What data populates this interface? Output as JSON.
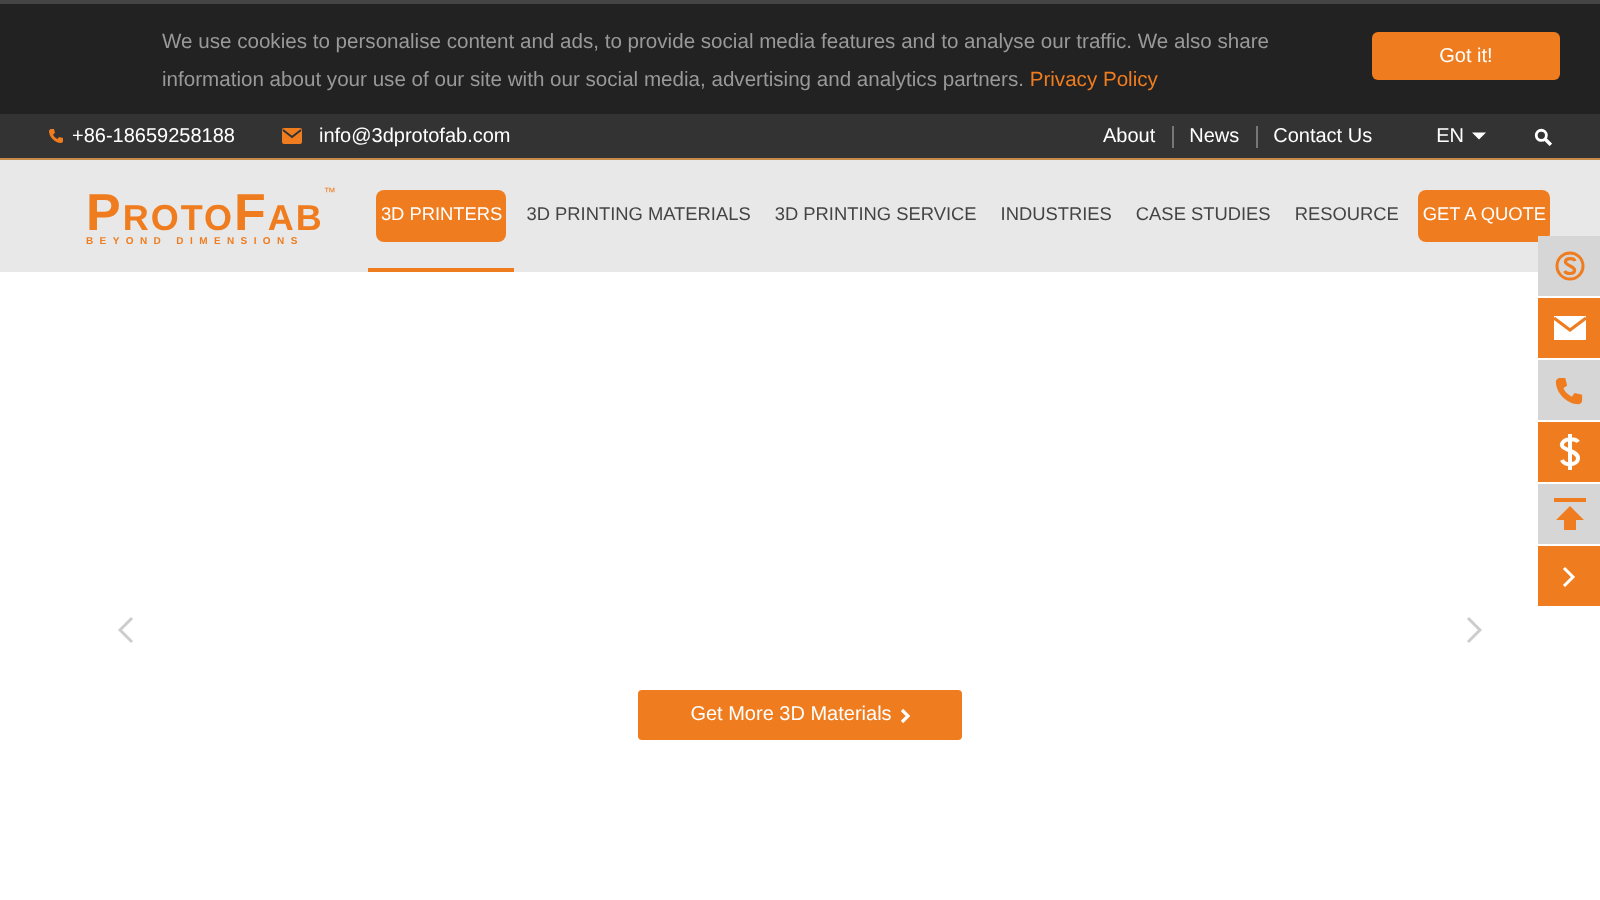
{
  "cookie_bar": {
    "message": "We use cookies to personalise content and ads, to provide social media features and to analyse our traffic. We also share information about your use of our site with our social media, advertising and analytics partners.",
    "link": "Privacy Policy",
    "button": "Got it!"
  },
  "top_bar": {
    "phone": "+86-18659258188",
    "email": "info@3dprotofab.com",
    "links": [
      "About",
      "News",
      "Contact Us"
    ],
    "language": "EN"
  },
  "header": {
    "logo": {
      "name": "ProtoFab",
      "trademark": "™",
      "tagline": "BEYOND DIMENSIONS"
    },
    "nav": [
      {
        "label": "3D PRINTERS",
        "kind": "link",
        "selected": true
      },
      {
        "label": "3D PRINTING MATERIALS",
        "kind": "link",
        "selected": false
      },
      {
        "label": "3D PRINTING SERVICE",
        "kind": "link",
        "selected": false
      },
      {
        "label": "INDUSTRIES",
        "kind": "link",
        "selected": false
      },
      {
        "label": "CASE STUDIES",
        "kind": "link",
        "selected": false
      },
      {
        "label": "RESOURCE",
        "kind": "link",
        "selected": false
      },
      {
        "label": "GET A QUOTE",
        "kind": "cta"
      }
    ]
  },
  "side_tools": [
    {
      "kind": "skype",
      "highlighted": false
    },
    {
      "kind": "email",
      "highlighted": true
    },
    {
      "kind": "phone",
      "highlighted": false
    },
    {
      "kind": "price",
      "highlighted": true
    },
    {
      "kind": "top",
      "highlighted": false
    },
    {
      "kind": "collapse",
      "highlighted": true
    }
  ],
  "slider": {
    "button": "Get More 3D Materials"
  }
}
